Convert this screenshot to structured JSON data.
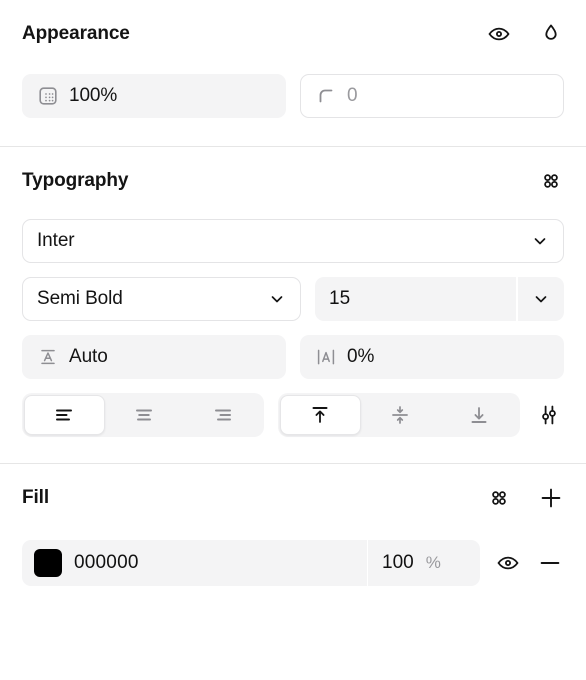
{
  "appearance": {
    "title": "Appearance",
    "actions": [
      {
        "name": "visibility-toggle",
        "icon": "eye-icon"
      },
      {
        "name": "blend-mode",
        "icon": "droplet-icon"
      }
    ],
    "opacity": {
      "label": "opacity",
      "value": "100%",
      "icon": "transparency-grid-icon"
    },
    "corner_radius": {
      "label": "corner-radius",
      "placeholder": "0",
      "value": "0",
      "icon": "corner-radius-icon"
    }
  },
  "typography": {
    "title": "Typography",
    "actions": [
      {
        "name": "text-styles",
        "icon": "four-dots-grid-icon"
      }
    ],
    "font_family": {
      "value": "Inter",
      "icon": "chevron-down-icon"
    },
    "font_weight": {
      "value": "Semi Bold",
      "icon": "chevron-down-icon"
    },
    "font_size": {
      "value": "15",
      "icon": "chevron-down-icon"
    },
    "line_height": {
      "value": "Auto",
      "icon": "line-height-icon"
    },
    "letter_spacing": {
      "value": "0%",
      "icon": "letter-spacing-icon"
    },
    "horizontal_align": {
      "selected": "left",
      "options": [
        {
          "value": "left",
          "icon": "align-left-icon"
        },
        {
          "value": "center",
          "icon": "align-center-icon"
        },
        {
          "value": "right",
          "icon": "align-right-icon"
        }
      ]
    },
    "vertical_align": {
      "selected": "top",
      "options": [
        {
          "value": "top",
          "icon": "align-top-icon"
        },
        {
          "value": "middle",
          "icon": "align-middle-icon"
        },
        {
          "value": "bottom",
          "icon": "align-bottom-icon"
        }
      ]
    },
    "more_settings": {
      "name": "type-settings",
      "icon": "sliders-icon"
    }
  },
  "fill": {
    "title": "Fill",
    "actions": [
      {
        "name": "color-styles",
        "icon": "four-dots-grid-icon"
      },
      {
        "name": "add-fill",
        "icon": "plus-icon"
      }
    ],
    "items": [
      {
        "color": "#000000",
        "hex": "000000",
        "opacity": "100",
        "opacity_unit": "%",
        "visible": true,
        "remove_icon": "minus-icon"
      }
    ]
  },
  "colors": {
    "field_bg": "#f4f4f5",
    "border": "#e4e4e6",
    "divider": "#e6e6e6",
    "text": "#141414",
    "muted": "#9a9a9e"
  }
}
